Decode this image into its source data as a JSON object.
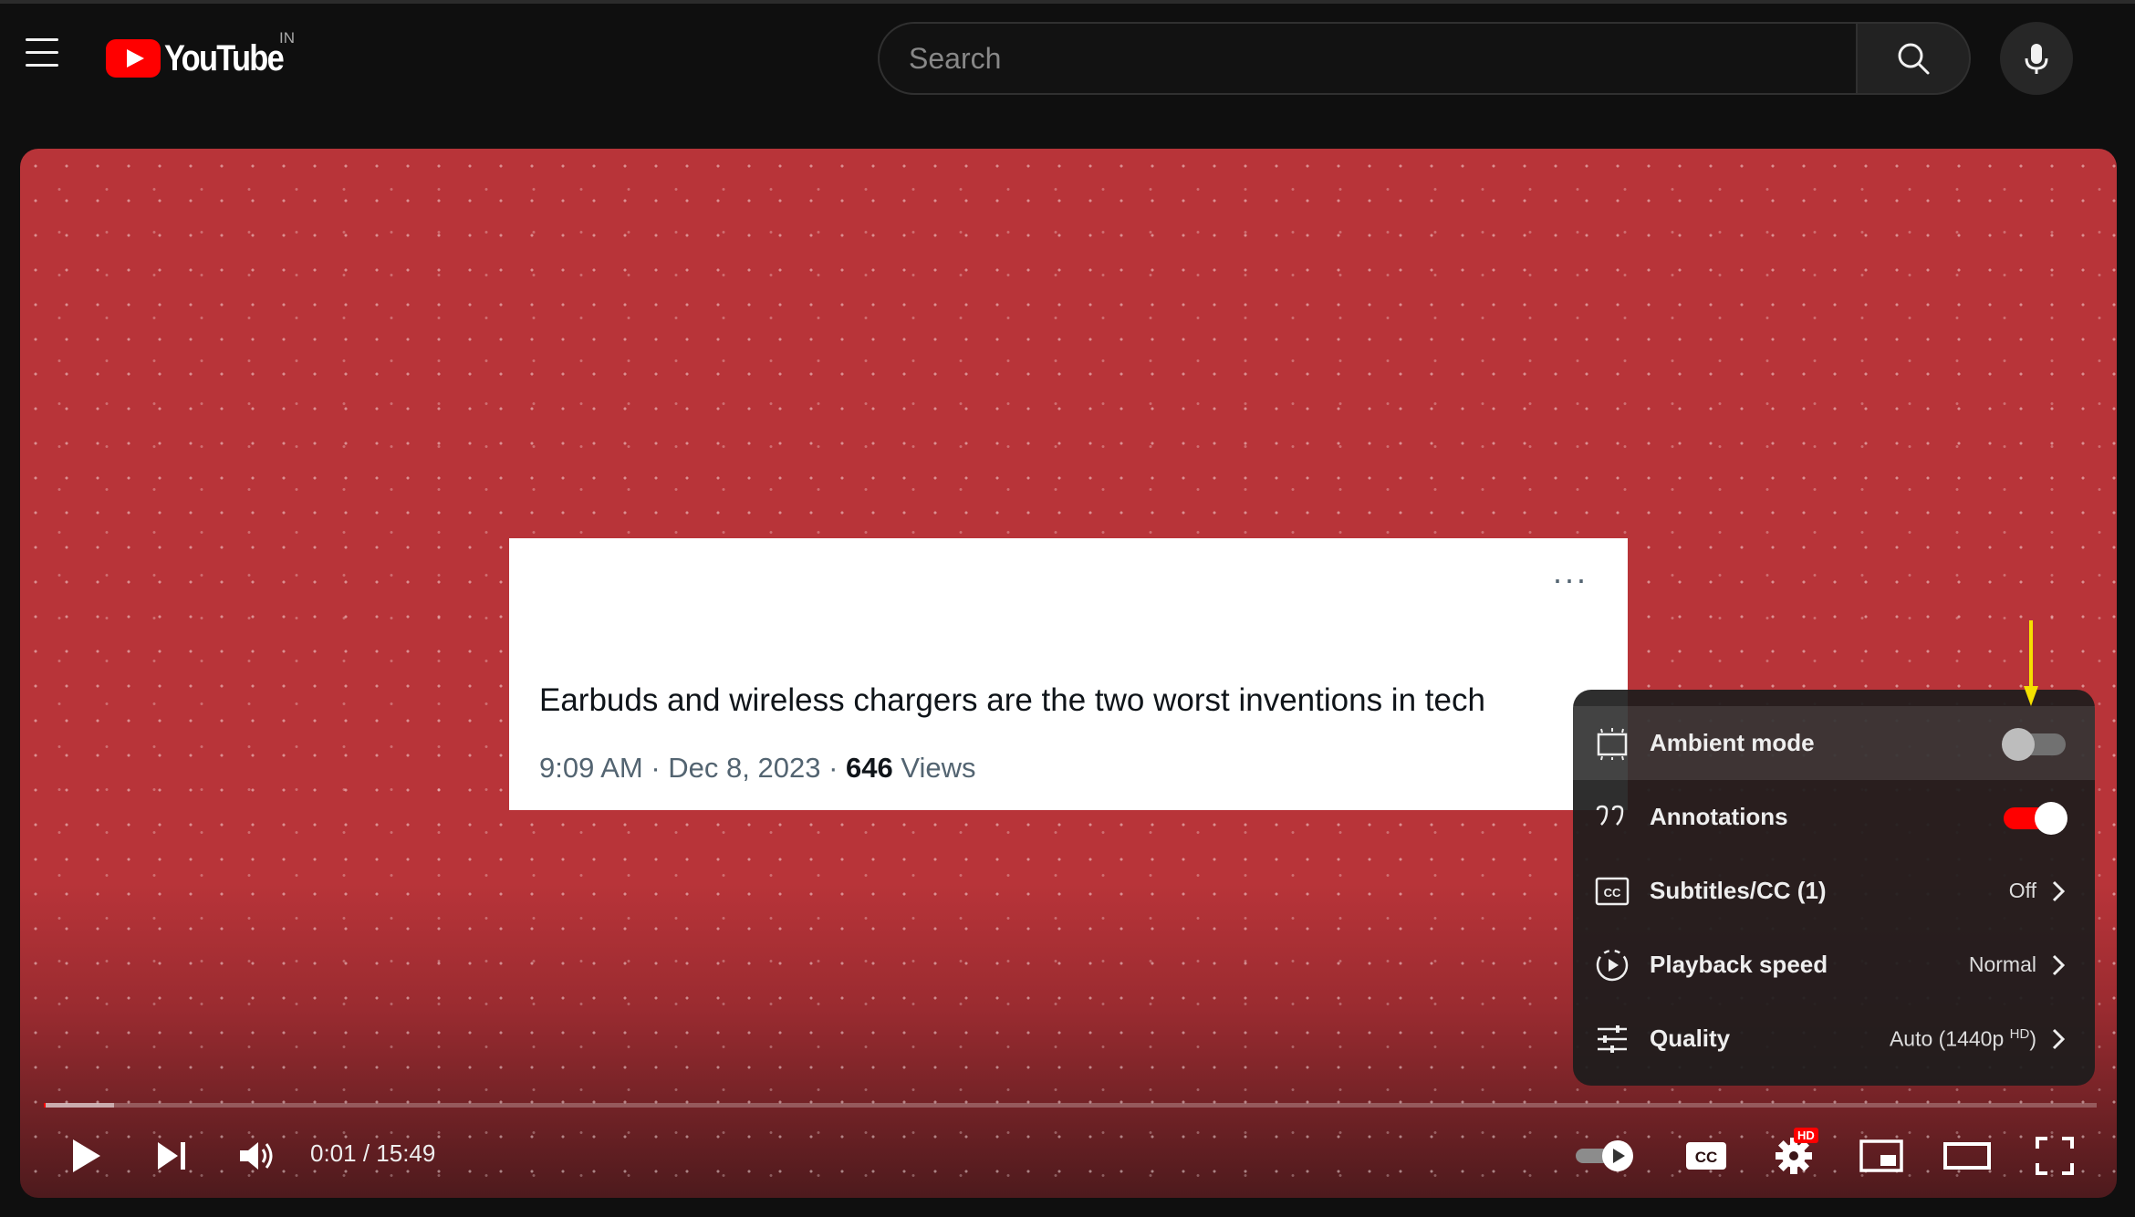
{
  "header": {
    "logo_text": "YouTube",
    "region": "IN",
    "search_placeholder": "Search"
  },
  "video": {
    "tweet": {
      "text": "Earbuds and wireless chargers are the two worst inventions in tech",
      "time": "9:09 AM · Dec 8, 2023 · ",
      "views_count": "646",
      "views_label": " Views",
      "more": "···"
    }
  },
  "settings_menu": {
    "items": [
      {
        "label": "Ambient mode",
        "icon": "ambient-icon",
        "toggle": "off"
      },
      {
        "label": "Annotations",
        "icon": "annotations-icon",
        "toggle": "on"
      },
      {
        "label": "Subtitles/CC (1)",
        "icon": "cc-icon",
        "value": "Off"
      },
      {
        "label": "Playback speed",
        "icon": "playback-speed-icon",
        "value": "Normal"
      },
      {
        "label": "Quality",
        "icon": "quality-icon",
        "value": "Auto (1440p",
        "value_sup": "HD",
        "value_close": ")"
      }
    ]
  },
  "player": {
    "time_current": "0:01",
    "time_total": "15:49",
    "time_display": "0:01 / 15:49",
    "progress_played_fraction": 0.001,
    "progress_loaded_fraction": 0.034,
    "settings_badge": "HD",
    "cc_label": "CC"
  },
  "colors": {
    "accent": "#ff0000",
    "video_bg": "#b83439",
    "annotation_arrow": "#f5e000"
  }
}
